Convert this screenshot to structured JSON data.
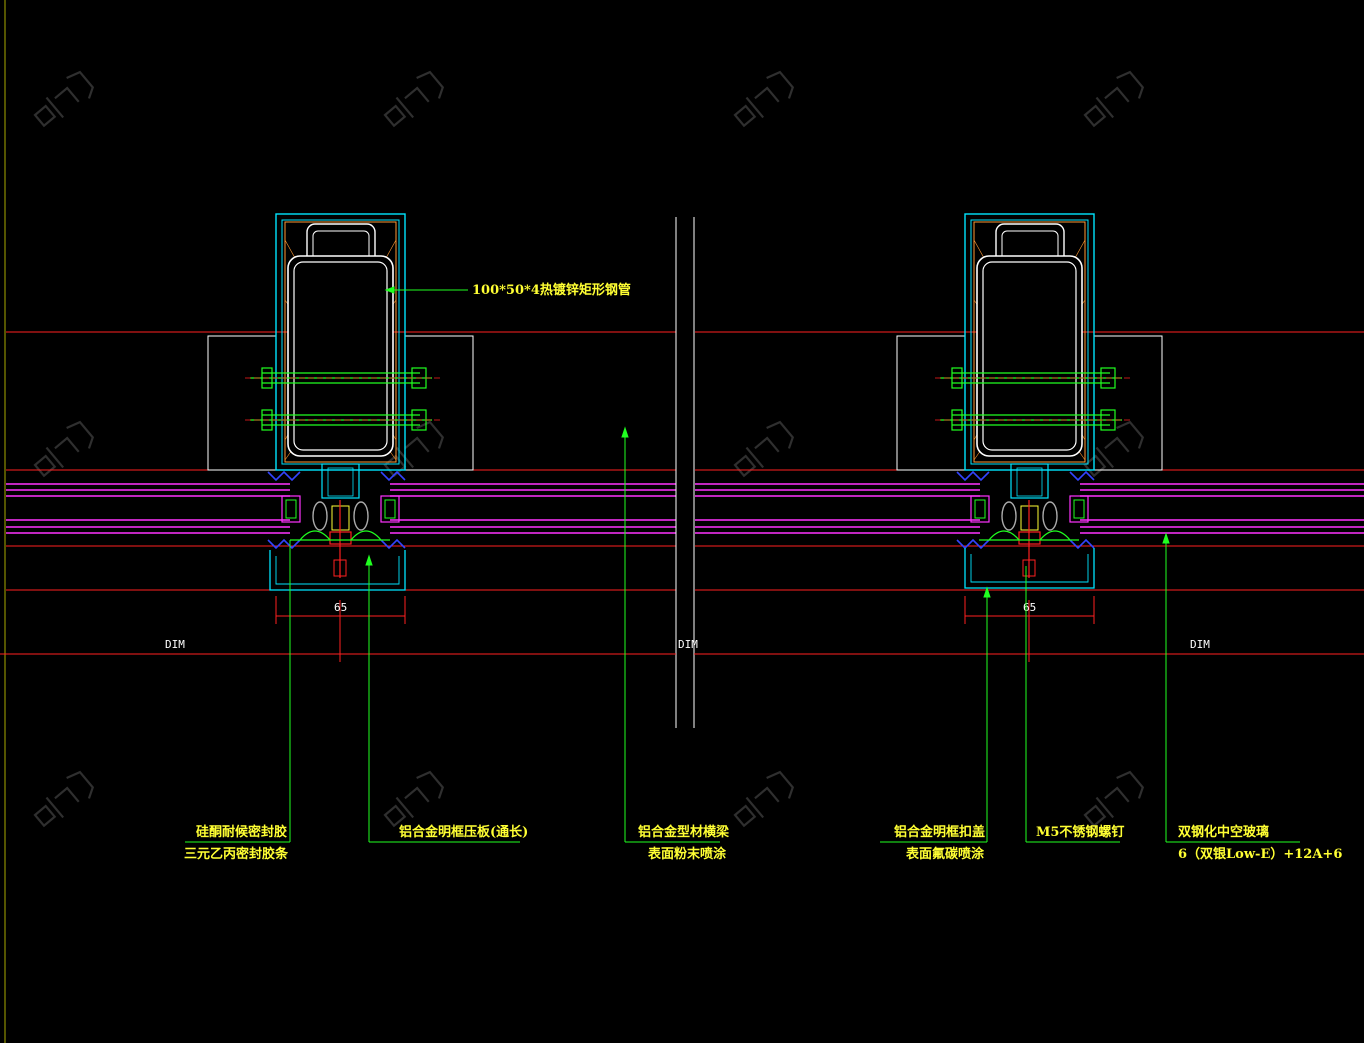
{
  "drawing": {
    "background": "#000000",
    "colors": {
      "cyan": "#00e5ff",
      "red": "#ff2020",
      "green": "#20ff20",
      "yellow": "#ffff33",
      "magenta": "#ff33ff",
      "orange": "#ff9933",
      "white": "#ffffff",
      "blue": "#3344ff",
      "gray": "#aaaaaa",
      "watermark": "#555555"
    },
    "dims": {
      "left_width": "65",
      "right_width": "65",
      "dim_label": "DIM"
    },
    "labels": {
      "steel_tube": "100*50*4热镀锌矩形钢管",
      "sealant_line1": "硅酮耐候密封胶",
      "sealant_line2": "三元乙丙密封胶条",
      "pressure_plate": "铝合金明框压板(通长)",
      "transom_line1": "铝合金型材横梁",
      "transom_line2": "表面粉末喷涂",
      "cover_line1": "铝合金明框扣盖",
      "cover_line2": "表面氟碳喷涂",
      "screw": "M5不锈钢螺钉",
      "glass_line1": "双钢化中空玻璃",
      "glass_line2": "6（双银Low-E）+12A+6"
    },
    "watermark_text": "知末"
  }
}
